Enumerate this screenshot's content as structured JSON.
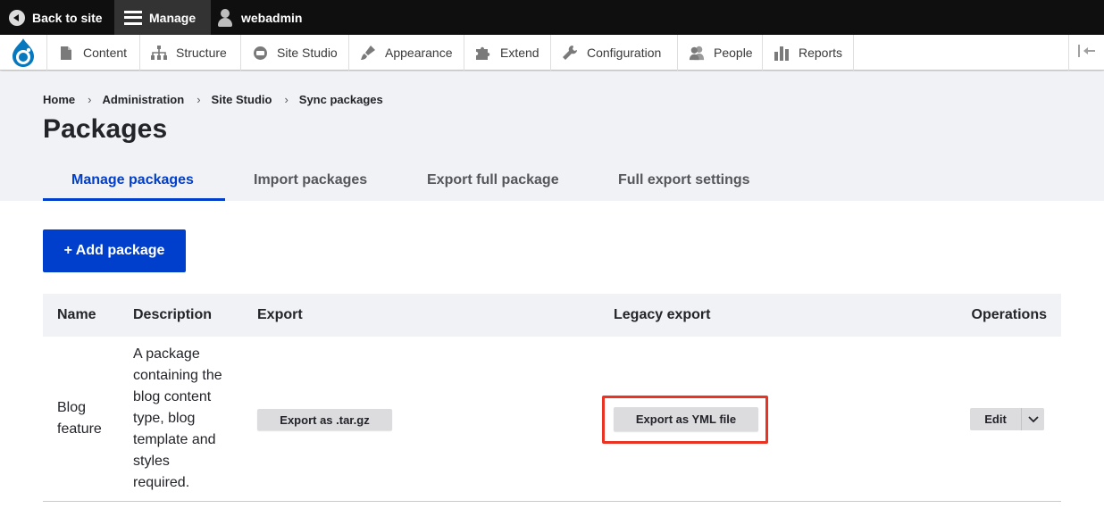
{
  "toolbar": {
    "back_label": "Back to site",
    "manage_label": "Manage",
    "user_label": "webadmin"
  },
  "admin_menu": {
    "items": [
      {
        "label": "Content",
        "icon": "page-icon"
      },
      {
        "label": "Structure",
        "icon": "sitemap-icon"
      },
      {
        "label": "Site Studio",
        "icon": "site-studio-icon"
      },
      {
        "label": "Appearance",
        "icon": "paintbrush-icon"
      },
      {
        "label": "Extend",
        "icon": "puzzle-icon"
      },
      {
        "label": "Configuration",
        "icon": "wrench-icon"
      },
      {
        "label": "People",
        "icon": "people-icon"
      },
      {
        "label": "Reports",
        "icon": "bar-chart-icon"
      }
    ]
  },
  "breadcrumb": [
    "Home",
    "Administration",
    "Site Studio",
    "Sync packages"
  ],
  "page": {
    "title": "Packages",
    "add_button": "+ Add package"
  },
  "tabs": [
    {
      "label": "Manage packages",
      "active": true
    },
    {
      "label": "Import packages",
      "active": false
    },
    {
      "label": "Export full package",
      "active": false
    },
    {
      "label": "Full export settings",
      "active": false
    }
  ],
  "table": {
    "headers": [
      "Name",
      "Description",
      "Export",
      "Legacy export",
      "Operations"
    ],
    "rows": [
      {
        "name_lines": [
          "Blog",
          "feature"
        ],
        "description_lines": [
          "A package",
          "containing the",
          "blog content",
          "type, blog",
          "template and",
          "styles",
          "required."
        ],
        "export_button": "Export as .tar.gz",
        "legacy_button": "Export as YML file",
        "edit_button": "Edit"
      }
    ]
  },
  "colors": {
    "accent": "#003ecc",
    "highlight": "#ea3323",
    "toolbar": "#0f0f0f"
  }
}
